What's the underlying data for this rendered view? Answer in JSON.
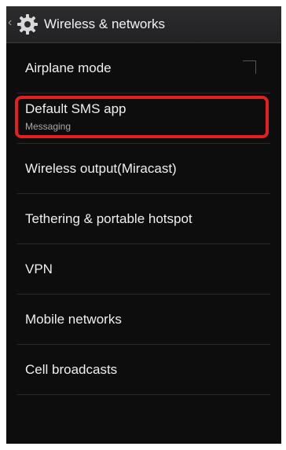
{
  "header": {
    "title": "Wireless & networks",
    "back_glyph": "‹",
    "icon": "settings-gear-icon"
  },
  "settings": {
    "items": [
      {
        "label": "Airplane mode",
        "control": "checkbox"
      },
      {
        "label": "Default SMS app",
        "summary": "Messaging",
        "highlighted": true
      },
      {
        "label": "Wireless output(Miracast)"
      },
      {
        "label": "Tethering & portable hotspot"
      },
      {
        "label": "VPN"
      },
      {
        "label": "Mobile networks"
      },
      {
        "label": "Cell broadcasts"
      }
    ]
  },
  "colors": {
    "background": "#0d0d0e",
    "action_bar": "#2c2c2e",
    "text_primary": "#efefef",
    "text_secondary": "#a9a9a9",
    "highlight": "#e41f1f"
  }
}
